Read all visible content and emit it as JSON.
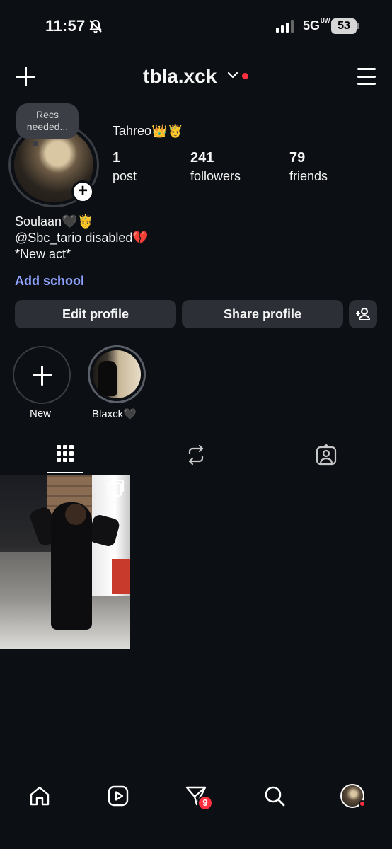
{
  "status_bar": {
    "time": "11:57",
    "network": "5G",
    "network_sup": "UW",
    "battery": "53"
  },
  "header": {
    "username": "tbla.xck"
  },
  "profile": {
    "note": "Recs needed...",
    "display_name": "Tahreo👑🤴",
    "stats": {
      "posts_count": "1",
      "posts_label": "post",
      "followers_count": "241",
      "followers_label": "followers",
      "friends_count": "79",
      "friends_label": "friends"
    },
    "bio": [
      "Soulaan🖤🤴",
      "@Sbc_tario disabled💔",
      "*New act*"
    ],
    "add_school": "Add school"
  },
  "actions": {
    "edit_profile": "Edit profile",
    "share_profile": "Share profile"
  },
  "highlights": [
    {
      "label": "New"
    },
    {
      "label": "Blaxck🖤"
    }
  ],
  "bottom_nav": {
    "dm_badge": "9"
  },
  "colors": {
    "background": "#0c0f14",
    "button": "#2c2f36",
    "link": "#8fa2ff",
    "badge": "#ff3040"
  }
}
